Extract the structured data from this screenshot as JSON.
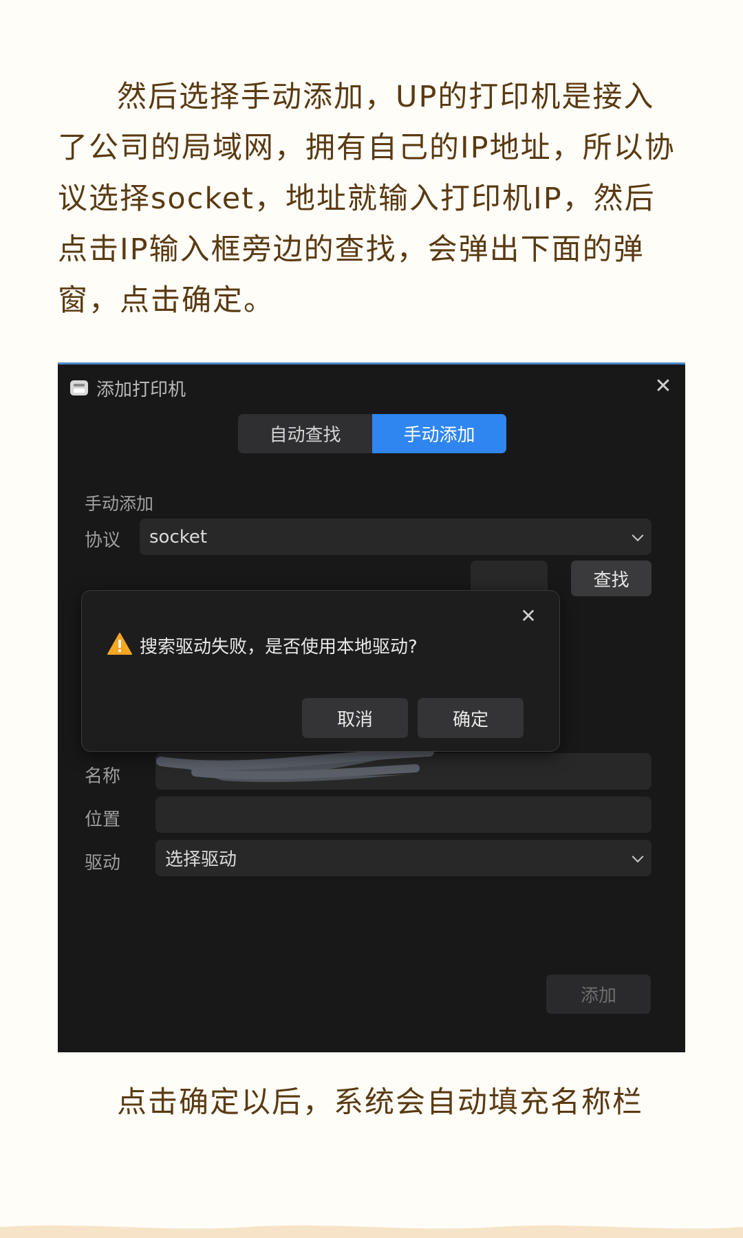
{
  "article": {
    "paragraph_top": "然后选择手动添加，UP的打印机是接入了公司的局域网，拥有自己的IP地址，所以协议选择socket，地址就输入打印机IP，然后点击IP输入框旁边的查找，会弹出下面的弹窗，点击确定。",
    "paragraph_bottom": "点击确定以后，系统会自动填充名称栏"
  },
  "window": {
    "title": "添加打印机",
    "close_icon": "close-icon",
    "tabs": [
      {
        "label": "自动查找",
        "active": false
      },
      {
        "label": "手动添加",
        "active": true
      }
    ],
    "section_title": "手动添加",
    "protocol": {
      "label": "协议",
      "value": "socket"
    },
    "find_button": "查找",
    "name": {
      "label": "名称",
      "value": ""
    },
    "location": {
      "label": "位置",
      "value": ""
    },
    "driver": {
      "label": "驱动",
      "value": "选择驱动"
    },
    "add_button": "添加"
  },
  "dialog": {
    "icon": "warning-icon",
    "message": "搜索驱动失败，是否使用本地驱动?",
    "cancel_button": "取消",
    "confirm_button": "确定"
  },
  "colors": {
    "accent": "#2f86f0",
    "text_brown": "#5a3a12",
    "window_bg": "#181818",
    "warning": "#f5a623"
  }
}
